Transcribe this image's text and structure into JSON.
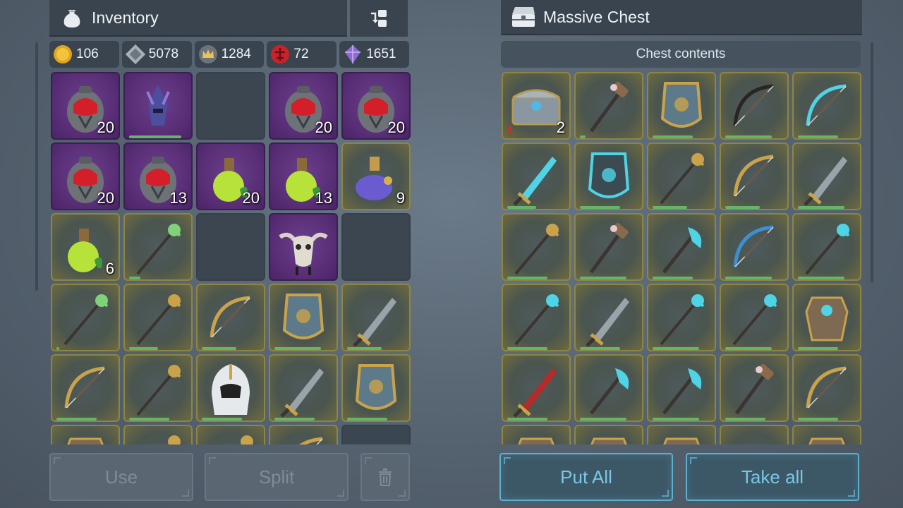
{
  "inventory": {
    "title": "Inventory",
    "currencies": [
      {
        "icon": "gold-coin-icon",
        "value": "106"
      },
      {
        "icon": "silver-coin-icon",
        "value": "5078"
      },
      {
        "icon": "crown-icon",
        "value": "1284"
      },
      {
        "icon": "red-emblem-icon",
        "value": "72"
      },
      {
        "icon": "crystal-icon",
        "value": "1651"
      }
    ],
    "slots": [
      {
        "item": "flask-red-icon",
        "rarity": "purple",
        "qty": "20"
      },
      {
        "item": "horned-helmet-icon",
        "rarity": "purple",
        "qty": "",
        "durability": 0.9
      },
      {
        "item": "",
        "rarity": "empty",
        "qty": ""
      },
      {
        "item": "flask-red-icon",
        "rarity": "purple",
        "qty": "20"
      },
      {
        "item": "flask-red-icon",
        "rarity": "purple",
        "qty": "20"
      },
      {
        "item": "flask-red-icon",
        "rarity": "purple",
        "qty": "20"
      },
      {
        "item": "flask-red-icon",
        "rarity": "purple",
        "qty": "13"
      },
      {
        "item": "potion-green-icon",
        "rarity": "purple",
        "qty": "20"
      },
      {
        "item": "potion-green-icon",
        "rarity": "purple",
        "qty": "13"
      },
      {
        "item": "potion-blue-icon",
        "rarity": "gold",
        "qty": "9"
      },
      {
        "item": "potion-green-icon",
        "rarity": "gold",
        "qty": "6"
      },
      {
        "item": "green-staff-icon",
        "rarity": "gold",
        "qty": "",
        "durability": 0.2
      },
      {
        "item": "",
        "rarity": "empty",
        "qty": ""
      },
      {
        "item": "bull-skull-icon",
        "rarity": "purple",
        "qty": ""
      },
      {
        "item": "",
        "rarity": "empty",
        "qty": ""
      },
      {
        "item": "green-staff-icon",
        "rarity": "gold",
        "qty": "",
        "durability": 0.05
      },
      {
        "item": "gold-staff-icon",
        "rarity": "gold",
        "qty": "",
        "durability": 0.5
      },
      {
        "item": "gold-bow-icon",
        "rarity": "gold",
        "qty": "",
        "durability": 0.6
      },
      {
        "item": "shield-icon",
        "rarity": "gold",
        "qty": "",
        "durability": 0.8
      },
      {
        "item": "greatsword-icon",
        "rarity": "gold",
        "qty": "",
        "durability": 0.6
      },
      {
        "item": "crossbow-icon",
        "rarity": "gold",
        "qty": "",
        "durability": 0.7
      },
      {
        "item": "ornate-staff-icon",
        "rarity": "gold",
        "qty": "",
        "durability": 0.7
      },
      {
        "item": "hood-icon",
        "rarity": "gold",
        "qty": "",
        "durability": 0.7
      },
      {
        "item": "curved-dagger-icon",
        "rarity": "gold",
        "qty": "",
        "durability": 0.7
      },
      {
        "item": "shield-icon",
        "rarity": "gold",
        "qty": "",
        "durability": 0.7
      },
      {
        "item": "armor-icon",
        "rarity": "gold",
        "qty": ""
      },
      {
        "item": "ornate-staff-icon",
        "rarity": "gold",
        "qty": ""
      },
      {
        "item": "gem-staff-icon",
        "rarity": "gold",
        "qty": ""
      },
      {
        "item": "gold-bow-icon",
        "rarity": "gold",
        "qty": ""
      },
      {
        "item": "",
        "rarity": "empty",
        "qty": ""
      }
    ],
    "buttons": {
      "use": "Use",
      "split": "Split",
      "trash_icon": "trash-icon"
    }
  },
  "chest": {
    "title": "Massive Chest",
    "subtitle": "Chest contents",
    "slots": [
      {
        "item": "chest-icon",
        "rarity": "gold",
        "qty": "2",
        "owner_icon": "person-icon"
      },
      {
        "item": "hammer-icon",
        "rarity": "gold",
        "qty": "",
        "durability": 0.1
      },
      {
        "item": "shield-icon",
        "rarity": "gold",
        "qty": "",
        "durability": 0.7
      },
      {
        "item": "scythe-icon",
        "rarity": "gold",
        "qty": "",
        "durability": 0.8
      },
      {
        "item": "cyan-bow-icon",
        "rarity": "gold",
        "qty": "",
        "durability": 0.7
      },
      {
        "item": "cyan-sword-icon",
        "rarity": "gold",
        "qty": "",
        "durability": 0.5
      },
      {
        "item": "cyan-shield-icon",
        "rarity": "gold",
        "qty": "",
        "durability": 0.7
      },
      {
        "item": "gold-staff-icon",
        "rarity": "gold",
        "qty": "",
        "durability": 0.6
      },
      {
        "item": "crossbow-icon",
        "rarity": "gold",
        "qty": "",
        "durability": 0.6
      },
      {
        "item": "greatsword-icon",
        "rarity": "gold",
        "qty": "",
        "durability": 0.8
      },
      {
        "item": "ornate-staff-icon",
        "rarity": "gold",
        "qty": "",
        "durability": 0.7
      },
      {
        "item": "hammer-icon",
        "rarity": "gold",
        "qty": "",
        "durability": 0.8
      },
      {
        "item": "cyan-axe-staff-icon",
        "rarity": "gold",
        "qty": "",
        "durability": 0.7
      },
      {
        "item": "blue-bow-icon",
        "rarity": "gold",
        "qty": "",
        "durability": 0.8
      },
      {
        "item": "cyan-staff-icon",
        "rarity": "gold",
        "qty": "",
        "durability": 0.8
      },
      {
        "item": "cyan-staff-icon",
        "rarity": "gold",
        "qty": "",
        "durability": 0.7
      },
      {
        "item": "greatsword-icon",
        "rarity": "gold",
        "qty": "",
        "durability": 0.7
      },
      {
        "item": "cyan-spear-icon",
        "rarity": "gold",
        "qty": "",
        "durability": 0.8
      },
      {
        "item": "cyan-spear-icon",
        "rarity": "gold",
        "qty": "",
        "durability": 0.8
      },
      {
        "item": "plate-armor-icon",
        "rarity": "gold",
        "qty": "",
        "durability": 0.7
      },
      {
        "item": "red-sword-icon",
        "rarity": "gold",
        "qty": "",
        "durability": 0.7
      },
      {
        "item": "cyan-axe-icon",
        "rarity": "gold",
        "qty": "",
        "durability": 0.8
      },
      {
        "item": "cyan-axe-icon",
        "rarity": "gold",
        "qty": "",
        "durability": 0.8
      },
      {
        "item": "hammer-icon",
        "rarity": "gold",
        "qty": "",
        "durability": 0.7
      },
      {
        "item": "gold-bow-icon",
        "rarity": "gold",
        "qty": "",
        "durability": 0.7
      },
      {
        "item": "helmet-icon",
        "rarity": "gold",
        "qty": ""
      },
      {
        "item": "chest-armor-icon",
        "rarity": "gold",
        "qty": ""
      },
      {
        "item": "cloth-icon",
        "rarity": "gold",
        "qty": ""
      },
      {
        "item": "gold-orb-icon",
        "rarity": "gold",
        "qty": ""
      },
      {
        "item": "armor-icon",
        "rarity": "gold",
        "qty": ""
      }
    ],
    "buttons": {
      "put_all": "Put All",
      "take_all": "Take all"
    }
  },
  "colors": {
    "accent": "#79c6e6",
    "purple_rarity": "#5a2f78",
    "gold_rarity": "#8d8544",
    "durability": "#64b56a"
  }
}
